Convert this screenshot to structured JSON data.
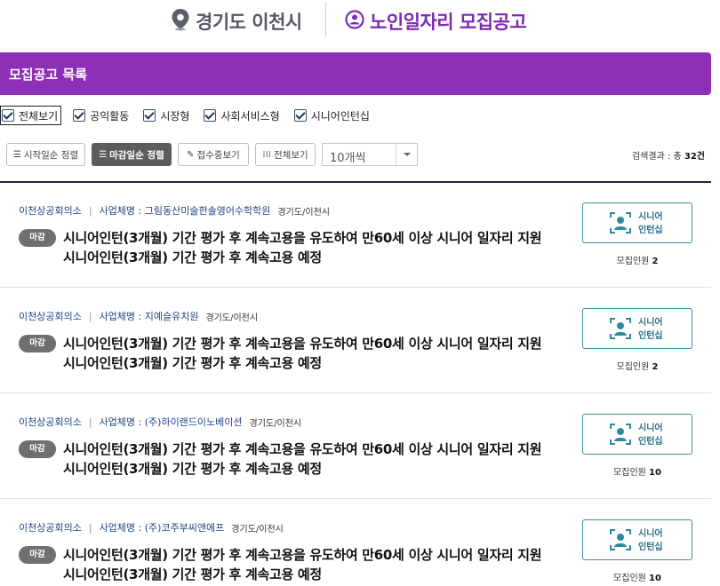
{
  "header": {
    "location": "경기도 이천시",
    "title": "노인일자리 모집공고",
    "location_icon": "map-pin-icon",
    "title_icon": "person-circle-icon"
  },
  "section": {
    "title": "모집공고 목록"
  },
  "filters": [
    {
      "label": "전체보기",
      "checked": true
    },
    {
      "label": "공익활동",
      "checked": true
    },
    {
      "label": "시장형",
      "checked": true
    },
    {
      "label": "사회서비스형",
      "checked": true
    },
    {
      "label": "시니어인턴십",
      "checked": true
    }
  ],
  "toolbar": {
    "sort_start": "시작일순 정렬",
    "sort_deadline": "마감일순 정렬",
    "receiving": "접수중보기",
    "view_all": "전체보기",
    "page_size": "10개씩",
    "result_prefix": "검색결과 : 총 ",
    "result_count": "32건"
  },
  "listings": [
    {
      "org": "이천상공회의소",
      "business": "사업체명 : 그림동산미술한솔영어수학학원",
      "location": "경기도/이천시",
      "status": "마감",
      "title_line1": "시니어인턴(3개월) 기간 평가 후 계속고용을 유도하여 만60세 이상 시니어 일자리 지원",
      "title_line2": "시니어인턴(3개월) 기간 평가 후 계속고용 예정",
      "type_line1": "시니어",
      "type_line2": "인턴십",
      "recruit_label": "모집인원 ",
      "recruit_count": "2"
    },
    {
      "org": "이천상공회의소",
      "business": "사업체명 : 지예슬유치원",
      "location": "경기도/이천시",
      "status": "마감",
      "title_line1": "시니어인턴(3개월) 기간 평가 후 계속고용을 유도하여 만60세 이상 시니어 일자리 지원",
      "title_line2": "시니어인턴(3개월) 기간 평가 후 계속고용 예정",
      "type_line1": "시니어",
      "type_line2": "인턴십",
      "recruit_label": "모집인원 ",
      "recruit_count": "2"
    },
    {
      "org": "이천상공회의소",
      "business": "사업체명 : (주)하이랜드이노베이션",
      "location": "경기도/이천시",
      "status": "마감",
      "title_line1": "시니어인턴(3개월) 기간 평가 후 계속고용을 유도하여 만60세 이상 시니어 일자리 지원",
      "title_line2": "시니어인턴(3개월) 기간 평가 후 계속고용 예정",
      "type_line1": "시니어",
      "type_line2": "인턴십",
      "recruit_label": "모집인원 ",
      "recruit_count": "10"
    },
    {
      "org": "이천상공회의소",
      "business": "사업체명 : (주)코주부씨앤에프",
      "location": "경기도/이천시",
      "status": "마감",
      "title_line1": "시니어인턴(3개월) 기간 평가 후 계속고용을 유도하여 만60세 이상 시니어 일자리 지원",
      "title_line2": "시니어인턴(3개월) 기간 평가 후 계속고용 예정",
      "type_line1": "시니어",
      "type_line2": "인턴십",
      "recruit_label": "모집인원 ",
      "recruit_count": "10"
    }
  ],
  "colors": {
    "brand_purple": "#8e2fb8",
    "link_blue": "#224488",
    "teal": "#3a8ca0",
    "closed_badge": "#6f6f6f"
  }
}
